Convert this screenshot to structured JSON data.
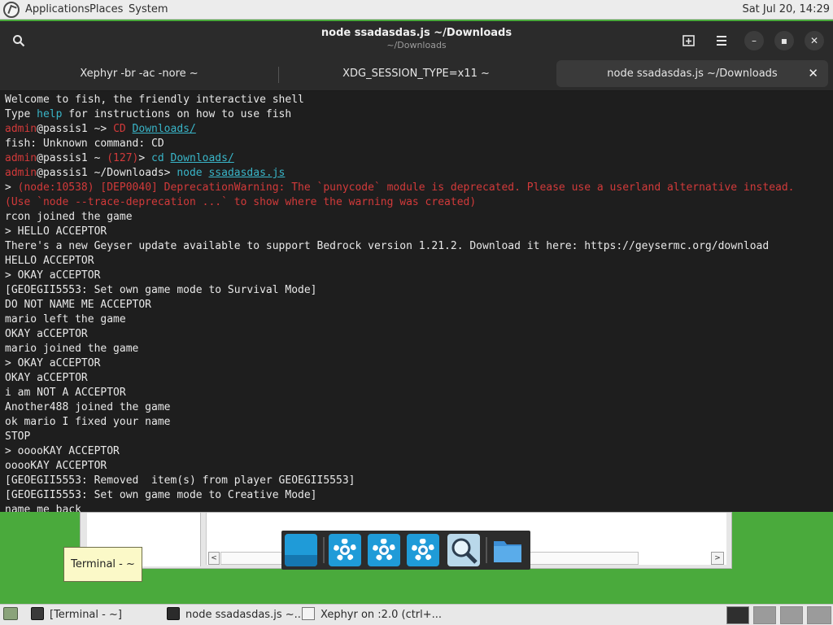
{
  "top_panel": {
    "menus": [
      "Applications",
      "Places",
      "System"
    ],
    "clock": "Sat Jul 20, 14:29"
  },
  "terminal": {
    "title": "node ssadasdas.js ~/Downloads",
    "subtitle": "~/Downloads",
    "tabs": [
      {
        "label": "Xephyr -br -ac -nore ~"
      },
      {
        "label": "XDG_SESSION_TYPE=x11 ~"
      },
      {
        "label": "node ssadasdas.js ~/Downloads"
      }
    ],
    "lines": {
      "l01": "Welcome to fish, the friendly interactive shell",
      "l02a": "Type ",
      "l02b": "help",
      "l02c": " for instructions on how to use fish",
      "l03a": "admin",
      "l03b": "@passis1 ~> ",
      "l03c": "CD",
      "l03d": " ",
      "l03e": "Downloads/",
      "l04": "fish: Unknown command: CD",
      "l05a": "admin",
      "l05b": "@passis1 ~ ",
      "l05c": "(127)",
      "l05d": "> ",
      "l05e": "cd",
      "l05f": " ",
      "l05g": "Downloads/",
      "l06a": "admin",
      "l06b": "@passis1 ~/Downloads> ",
      "l06c": "node",
      "l06d": " ",
      "l06e": "ssadasdas.js",
      "l07a": "> ",
      "l07b": "(node:10538) [DEP0040] DeprecationWarning: The `punycode` module is deprecated. Please use a userland alternative instead.",
      "l08": "(Use `node --trace-deprecation ...` to show where the warning was created)",
      "l09": "rcon joined the game",
      "l10": "> HELLO ACCEPTOR",
      "l11": "There's a new Geyser update available to support Bedrock version 1.21.2. Download it here: https://geysermc.org/download",
      "l12": "HELLO ACCEPTOR",
      "l13": "> OKAY aCCEPTOR",
      "l14": "[GEOEGII5553: Set own game mode to Survival Mode]",
      "l15": "DO NOT NAME ME ACCEPTOR",
      "l16": "mario left the game",
      "l17": "OKAY aCCEPTOR",
      "l18": "mario joined the game",
      "l19": "> OKAY aCCEPTOR",
      "l20": "OKAY aCCEPTOR",
      "l21": "i am NOT A ACCEPTOR",
      "l22": "Another488 joined the game",
      "l23": "ok mario I fixed your name",
      "l24": "STOP",
      "l25": "> ooooKAY ACCEPTOR",
      "l26": "ooooKAY ACCEPTOR",
      "l27": "[GEOEGII5553: Removed  item(s) from player GEOEGII5553]",
      "l28": "[GEOEGII5553: Set own game mode to Creative Mode]",
      "l29": "name me back"
    }
  },
  "tooltip": "Terminal - ~",
  "taskbar": {
    "items": [
      {
        "label": "[Terminal - ~]"
      },
      {
        "label": "node ssadasdas.js ~..."
      },
      {
        "label": "Xephyr on :2.0 (ctrl+..."
      }
    ]
  },
  "colors": {
    "desktop": "#4aaa3c",
    "terminal_bg": "#1e1e1e",
    "prompt_red": "#d23a3a",
    "command_cyan": "#39b5c8"
  }
}
